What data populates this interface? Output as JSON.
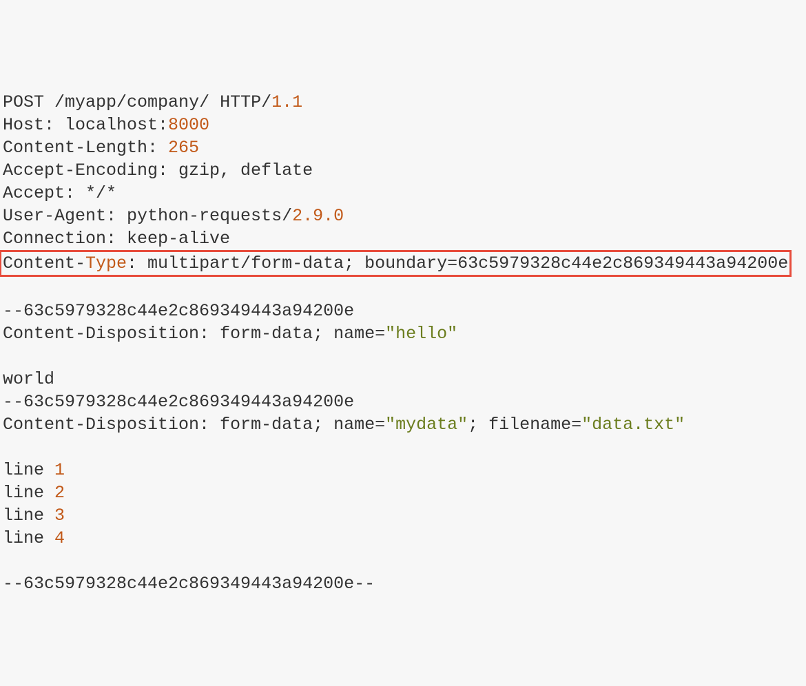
{
  "request": {
    "method": "POST",
    "path": "/myapp/company/",
    "http": "HTTP/",
    "http_version": "1.1"
  },
  "headers": {
    "host_label": "Host: ",
    "host_prefix": "localhost:",
    "host_port": "8000",
    "content_length_label": "Content-Length: ",
    "content_length_value": "265",
    "accept_encoding": "Accept-Encoding: gzip, deflate",
    "accept": "Accept: */*",
    "user_agent_prefix": "User-Agent: python-requests/",
    "user_agent_version": "2.9.0",
    "connection": "Connection: keep-alive",
    "content_type_prefix": "Content-",
    "content_type_word": "Type",
    "content_type_rest": ": multipart/form-data; boundary=63c5979328c44e2c869349443a94200e"
  },
  "body": {
    "boundary1": "--63c5979328c44e2c869349443a94200e",
    "disposition1_prefix": "Content-Disposition: form-data; name=",
    "disposition1_name": "\"hello\"",
    "value1": "world",
    "boundary2": "--63c5979328c44e2c869349443a94200e",
    "disposition2_prefix": "Content-Disposition: form-data; name=",
    "disposition2_name": "\"mydata\"",
    "disposition2_mid": "; filename=",
    "disposition2_filename": "\"data.txt\"",
    "line_label": "line ",
    "line_numbers": [
      "1",
      "2",
      "3",
      "4"
    ],
    "boundary_end_partial": "--63c5979328c44e2c869349443a94200e--"
  }
}
